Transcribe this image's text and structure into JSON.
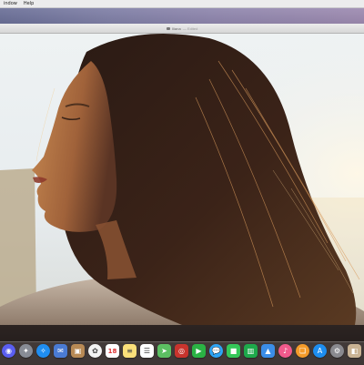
{
  "menubar": {
    "items": [
      "indow",
      "Help"
    ]
  },
  "window": {
    "title": "Iliana",
    "subtitle": "— Edited"
  },
  "dock": {
    "icons": [
      {
        "name": "siri-icon",
        "color": "#5a5ef0",
        "glyph": "◉",
        "round": true
      },
      {
        "name": "launchpad-icon",
        "color": "#888c95",
        "glyph": "✦",
        "round": true
      },
      {
        "name": "safari-icon",
        "color": "#1f8ef1",
        "glyph": "✧",
        "round": true
      },
      {
        "name": "mail-icon",
        "color": "#4a7bd3",
        "glyph": "✉",
        "round": false
      },
      {
        "name": "contacts-icon",
        "color": "#b88a55",
        "glyph": "▣",
        "round": false
      },
      {
        "name": "photos-icon",
        "color": "#f3f3f3",
        "glyph": "✿",
        "round": true
      },
      {
        "name": "calendar-icon",
        "color": "#ffffff",
        "glyph": "18",
        "round": false
      },
      {
        "name": "notes-icon",
        "color": "#fbe07a",
        "glyph": "≡",
        "round": false
      },
      {
        "name": "reminders-icon",
        "color": "#ffffff",
        "glyph": "☰",
        "round": false
      },
      {
        "name": "maps-icon",
        "color": "#5cbf62",
        "glyph": "➤",
        "round": false
      },
      {
        "name": "photo-booth-icon",
        "color": "#c8342d",
        "glyph": "◎",
        "round": false
      },
      {
        "name": "facetime-icon",
        "color": "#2bb344",
        "glyph": "▶",
        "round": false
      },
      {
        "name": "messages-icon",
        "color": "#2ea5f5",
        "glyph": "💬",
        "round": true
      },
      {
        "name": "facetime-video-icon",
        "color": "#34c759",
        "glyph": "■",
        "round": false
      },
      {
        "name": "numbers-icon",
        "color": "#1ea94b",
        "glyph": "▥",
        "round": false
      },
      {
        "name": "keynote-icon",
        "color": "#3b8ee8",
        "glyph": "▲",
        "round": false
      },
      {
        "name": "itunes-icon",
        "color": "#f05a8c",
        "glyph": "♪",
        "round": true
      },
      {
        "name": "books-icon",
        "color": "#f39b2a",
        "glyph": "❏",
        "round": true
      },
      {
        "name": "app-store-icon",
        "color": "#1d8ef0",
        "glyph": "A",
        "round": true
      },
      {
        "name": "system-preferences-icon",
        "color": "#8a8a8f",
        "glyph": "⚙",
        "round": true
      },
      {
        "name": "preview-icon",
        "color": "#c9b394",
        "glyph": "◧",
        "round": false
      }
    ]
  }
}
